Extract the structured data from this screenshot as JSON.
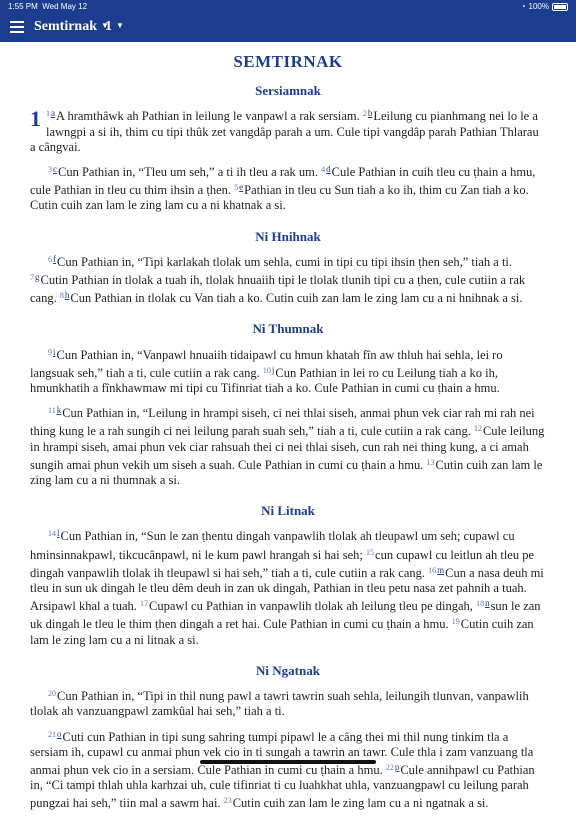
{
  "status": {
    "time": "1:55 PM",
    "date": "Wed May 12",
    "battery": "100%"
  },
  "nav": {
    "book": "Semtirnak",
    "chapter": "1"
  },
  "book_title": "SEMTIRNAK",
  "chapter_number": "1",
  "sections": [
    {
      "heading": "Sersiamnak",
      "paras": [
        [
          [
            "v",
            "1"
          ],
          [
            "f",
            "a"
          ],
          [
            "t",
            "A hramthâwk ah Pathian in leilung le vanpawl a rak sersiam. "
          ],
          [
            "v",
            "2"
          ],
          [
            "f",
            "b"
          ],
          [
            "t",
            "Leilung cu pianhmang nei lo le a lawngpi a si ih, thim cu tipi thûk zet vangdâp parah a um. Cule tipi vangdâp parah Pathian Thlarau a cângvai."
          ]
        ],
        [
          [
            "v",
            "3"
          ],
          [
            "f",
            "c"
          ],
          [
            "t",
            "Cun Pathian in, “Tleu um seh,” a ti ih tleu a rak um. "
          ],
          [
            "v",
            "4"
          ],
          [
            "f",
            "d"
          ],
          [
            "t",
            "Cule Pathian in cuih tleu cu ṭhain a hmu, cule Pathian in tleu cu thim ihsin a ṭhen. "
          ],
          [
            "v",
            "5"
          ],
          [
            "f",
            "e"
          ],
          [
            "t",
            "Pathian in tleu cu Sun tiah a ko ih, thim cu Zan tiah a ko. Cutin cuih zan lam le zing lam cu a ni khatnak a si."
          ]
        ]
      ]
    },
    {
      "heading": "Ni Hnihnak",
      "paras": [
        [
          [
            "v",
            "6"
          ],
          [
            "f",
            "f"
          ],
          [
            "t",
            "Cun Pathian in, “Tipi karlakah tlolak um sehla, cumi in tipi cu tipi ihsin ṭhen seh,” tiah a ti. "
          ],
          [
            "v",
            "7"
          ],
          [
            "f",
            "g"
          ],
          [
            "t",
            "Cutin Pathian in tlolak a tuah ih, tlolak hnuaiih tipi le tlolak tlunih tipi cu a ṭhen, cule cutiin a rak cang. "
          ],
          [
            "v",
            "8"
          ],
          [
            "f",
            "h"
          ],
          [
            "t",
            "Cun Pathian in tlolak cu Van tiah a ko. Cutin cuih zan lam le zing lam cu a ni hnihnak a si."
          ]
        ]
      ]
    },
    {
      "heading": "Ni Thumnak",
      "paras": [
        [
          [
            "v",
            "9"
          ],
          [
            "f",
            "i"
          ],
          [
            "t",
            "Cun Pathian in, “Vanpawl hnuaiih tidaipawl cu hmun khatah fîn aw thluh hai sehla, lei ro langsuak seh,” tiah a ti, cule cutiin a rak cang. "
          ],
          [
            "v",
            "10"
          ],
          [
            "f",
            "j"
          ],
          [
            "t",
            "Cun Pathian in lei ro cu Leilung tiah a ko ih, hmunkhatih a fînkhawmaw mi tipi cu Tifinriat tiah a ko. Cule Pathian in cumi cu ṭhain a hmu."
          ]
        ],
        [
          [
            "v",
            "11"
          ],
          [
            "f",
            "k"
          ],
          [
            "t",
            "Cun Pathian in, “Leilung in hrampi siseh, ci nei thlai siseh, anmai phun vek ciar rah mi rah nei thing kung le a rah sungih ci nei leilung parah suah seh,” tiah a ti, cule cutiin a rak cang. "
          ],
          [
            "v",
            "12"
          ],
          [
            "t",
            "Cule leilung in hrampi siseh, amai phun vek ciar rahsuah thei ci nei thlai siseh, cun rah nei thing kung, a ci amah sungih amai phun vekih um siseh a suah. Cule Pathian in cumi cu ṭhain a hmu. "
          ],
          [
            "v",
            "13"
          ],
          [
            "t",
            "Cutin cuih zan lam le zing lam cu a ni thumnak a si."
          ]
        ]
      ]
    },
    {
      "heading": "Ni Litnak",
      "paras": [
        [
          [
            "v",
            "14"
          ],
          [
            "f",
            "l"
          ],
          [
            "t",
            "Cun Pathian in, “Sun le zan ṭhentu dingah vanpawlih tlolak ah tleupawl um seh; cupawl cu hminsinnakpawl, tikcucânpawl, ni le kum pawl hrangah si hai seh; "
          ],
          [
            "v",
            "15"
          ],
          [
            "t",
            "cun cupawl cu leitlun ah tleu pe dingah vanpawlih tlolak ih tleupawl si hai seh,” tiah a ti, cule cutiin a rak cang. "
          ],
          [
            "v",
            "16"
          ],
          [
            "f",
            "m"
          ],
          [
            "t",
            "Cun a nasa deuh mi tleu in sun uk dingah le tleu dêm deuh in zan uk dingah, Pathian in tleu petu nasa zet pahnih a tuah. Arsipawl khal a tuah. "
          ],
          [
            "v",
            "17"
          ],
          [
            "t",
            "Cupawl cu Pathian in vanpawlih tlolak ah leilung tleu pe dingah, "
          ],
          [
            "v",
            "18"
          ],
          [
            "f",
            "n"
          ],
          [
            "t",
            "sun le zan uk dingah le tleu le thim ṭhen dingah a ret hai. Cule Pathian in cumi cu ṭhain a hmu. "
          ],
          [
            "v",
            "19"
          ],
          [
            "t",
            "Cutin cuih zan lam le zing lam cu a ni litnak a si."
          ]
        ]
      ]
    },
    {
      "heading": "Ni Ngatnak",
      "paras": [
        [
          [
            "v",
            "20"
          ],
          [
            "t",
            "Cun Pathian in, “Tipi in thil nung pawl a tawri tawrin suah sehla, leilungih tlunvan, vanpawlih tlolak ah vanzuangpawl zamkûal hai seh,” tiah a ti."
          ]
        ],
        [
          [
            "v",
            "21"
          ],
          [
            "f",
            "o"
          ],
          [
            "t",
            "Cuti cun Pathian in tipi sung sahring tumpi pipawl le a câng thei mi thil nung tinkim tla a sersiam ih, cupawl cu anmai phun vek cio in ti sungah a tawrin an tawr. Cule thla i zam vanzuang tla anmai phun vek cio in a sersiam. Cule Pathian in cumi cu ṭhain a hmu. "
          ],
          [
            "v",
            "22"
          ],
          [
            "f",
            "p"
          ],
          [
            "t",
            "Cule annihpawl cu Pathian in, “Ci tampi thlah uhla karhzai uh, cule tifinriat ti cu luahkhat uhla, vanzuangpawl cu leilung parah pungzai hai seh,” tiin mal a sawm hai. "
          ],
          [
            "v",
            "23"
          ],
          [
            "t",
            "Cutin cuih zan lam le zing lam cu a ni ngatnak a si."
          ]
        ]
      ]
    }
  ]
}
